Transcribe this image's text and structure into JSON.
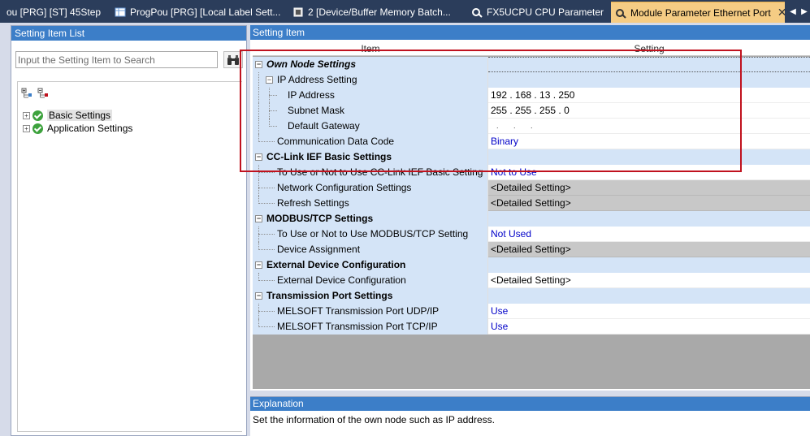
{
  "tabs": [
    {
      "label": "ou [PRG] [ST] 45Step",
      "icon": "program-icon"
    },
    {
      "label": "ProgPou [PRG] [Local Label Sett...",
      "icon": "label-table-icon"
    },
    {
      "label": "2 [Device/Buffer Memory Batch...",
      "icon": "device-memory-icon"
    },
    {
      "label": "FX5UCPU CPU Parameter",
      "icon": "cpu-parameter-icon"
    },
    {
      "label": "Module Parameter Ethernet Port",
      "icon": "module-parameter-icon"
    }
  ],
  "left": {
    "header": "Setting Item List",
    "search_placeholder": "Input the Setting Item to Search",
    "tree": [
      {
        "label": "Basic Settings"
      },
      {
        "label": "Application Settings"
      }
    ]
  },
  "right": {
    "header": "Setting Item",
    "col_item": "Item",
    "col_setting": "Setting",
    "rows": [
      {
        "item": "Own Node Settings",
        "setting": "",
        "type": "cat"
      },
      {
        "item": "IP Address Setting",
        "setting": "",
        "type": "subcat"
      },
      {
        "item": "IP Address",
        "setting": "192 . 168 . 13 . 250",
        "type": "leaf2"
      },
      {
        "item": "Subnet Mask",
        "setting": "255 . 255 . 255 .   0",
        "type": "leaf2"
      },
      {
        "item": "Default Gateway",
        "setting": ". . .",
        "type": "leaf2"
      },
      {
        "item": "Communication Data Code",
        "setting": "Binary",
        "type": "leaf"
      },
      {
        "item": "CC-Link IEF Basic Settings",
        "setting": "",
        "type": "cat"
      },
      {
        "item": "To Use or Not to Use CC-Link IEF Basic Setting",
        "setting": "Not to Use",
        "type": "leaf"
      },
      {
        "item": "Network Configuration Settings",
        "setting": "<Detailed Setting>",
        "type": "leaf"
      },
      {
        "item": "Refresh Settings",
        "setting": "<Detailed Setting>",
        "type": "leaf"
      },
      {
        "item": "MODBUS/TCP Settings",
        "setting": "",
        "type": "cat"
      },
      {
        "item": "To Use or Not to Use MODBUS/TCP Setting",
        "setting": "Not Used",
        "type": "leaf"
      },
      {
        "item": "Device Assignment",
        "setting": "<Detailed Setting>",
        "type": "leaf"
      },
      {
        "item": "External Device Configuration",
        "setting": "",
        "type": "cat"
      },
      {
        "item": "External Device Configuration",
        "setting": "<Detailed Setting>",
        "type": "leaf"
      },
      {
        "item": "Transmission Port Settings",
        "setting": "",
        "type": "cat"
      },
      {
        "item": "MELSOFT Transmission Port UDP/IP",
        "setting": "Use",
        "type": "leaf"
      },
      {
        "item": "MELSOFT Transmission Port TCP/IP",
        "setting": "Use",
        "type": "leaf"
      }
    ]
  },
  "explanation": {
    "header": "Explanation",
    "text": "Set the information of the own node such as IP address."
  },
  "colors": {
    "header_blue": "#3c7ec8",
    "item_bg": "#d4e4f7",
    "active_tab": "#f5cc84",
    "highlight_red": "#c0121e",
    "value_blue": "#0000c8"
  }
}
